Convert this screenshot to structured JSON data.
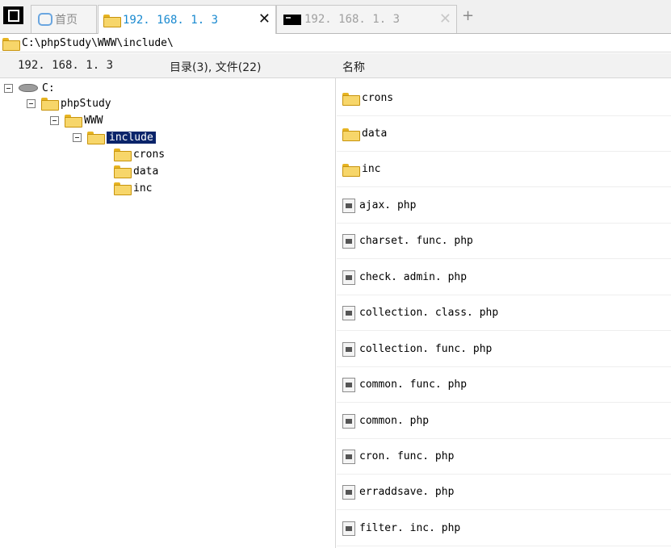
{
  "tabs": {
    "home_label": "首页",
    "active_label": "192. 168. 1. 3",
    "active_close": "✕",
    "inactive_label": "192. 168. 1. 3",
    "inactive_close": "✕",
    "add": "+"
  },
  "path": "C:\\phpStudy\\WWW\\include\\",
  "header": {
    "host": "192. 168. 1. 3",
    "count": "目录(3), 文件(22)",
    "name_col": "名称"
  },
  "tree": {
    "drive": "C:",
    "level1": "phpStudy",
    "level2": "WWW",
    "level3": "include",
    "children": [
      "crons",
      "data",
      "inc"
    ]
  },
  "files": [
    {
      "name": "crons",
      "type": "folder"
    },
    {
      "name": "data",
      "type": "folder"
    },
    {
      "name": "inc",
      "type": "folder"
    },
    {
      "name": "ajax. php",
      "type": "file"
    },
    {
      "name": "charset. func. php",
      "type": "file"
    },
    {
      "name": "check. admin. php",
      "type": "file"
    },
    {
      "name": "collection. class. php",
      "type": "file"
    },
    {
      "name": "collection. func. php",
      "type": "file"
    },
    {
      "name": "common. func. php",
      "type": "file"
    },
    {
      "name": "common. php",
      "type": "file"
    },
    {
      "name": "cron. func. php",
      "type": "file"
    },
    {
      "name": "erraddsave. php",
      "type": "file"
    },
    {
      "name": "filter. inc. php",
      "type": "file"
    }
  ],
  "icons": {
    "folder": "folder-icon",
    "file": "php-file-icon",
    "drive": "drive-icon"
  }
}
